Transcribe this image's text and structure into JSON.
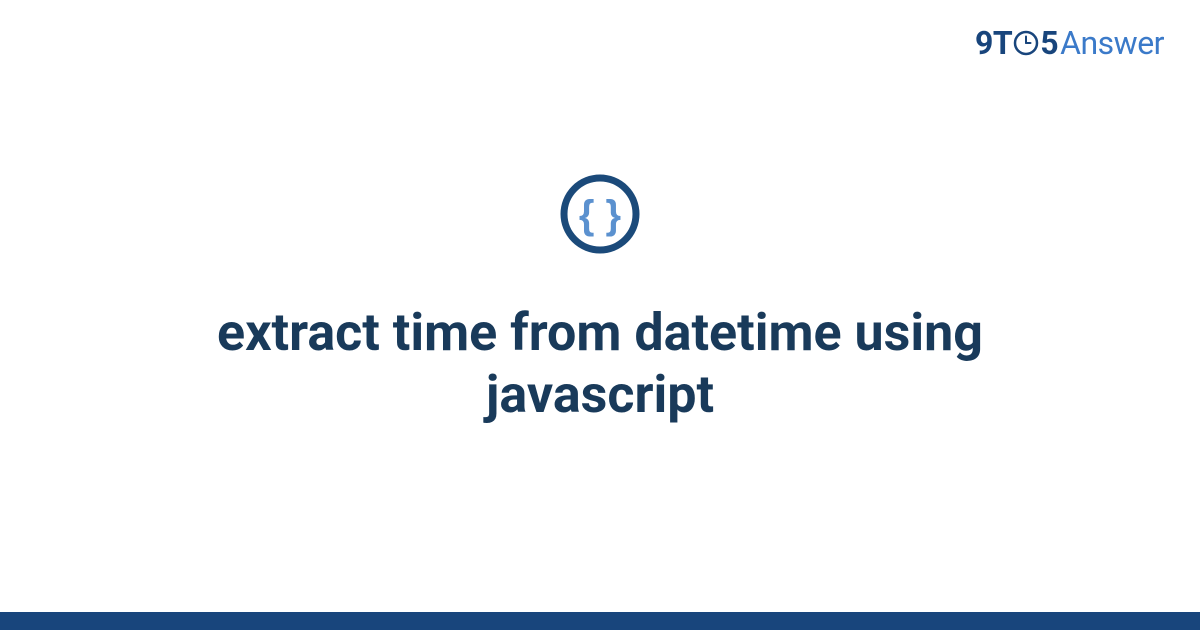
{
  "brand": {
    "part1": "9T",
    "part2": "5",
    "part3": "Answer"
  },
  "page": {
    "title": "extract time from datetime using javascript"
  },
  "colors": {
    "brandDark": "#18457c",
    "brandLight": "#3b7ac9",
    "titleColor": "#193a5a",
    "iconOuter": "#1b4a7a",
    "iconInner": "#5b91cf"
  }
}
